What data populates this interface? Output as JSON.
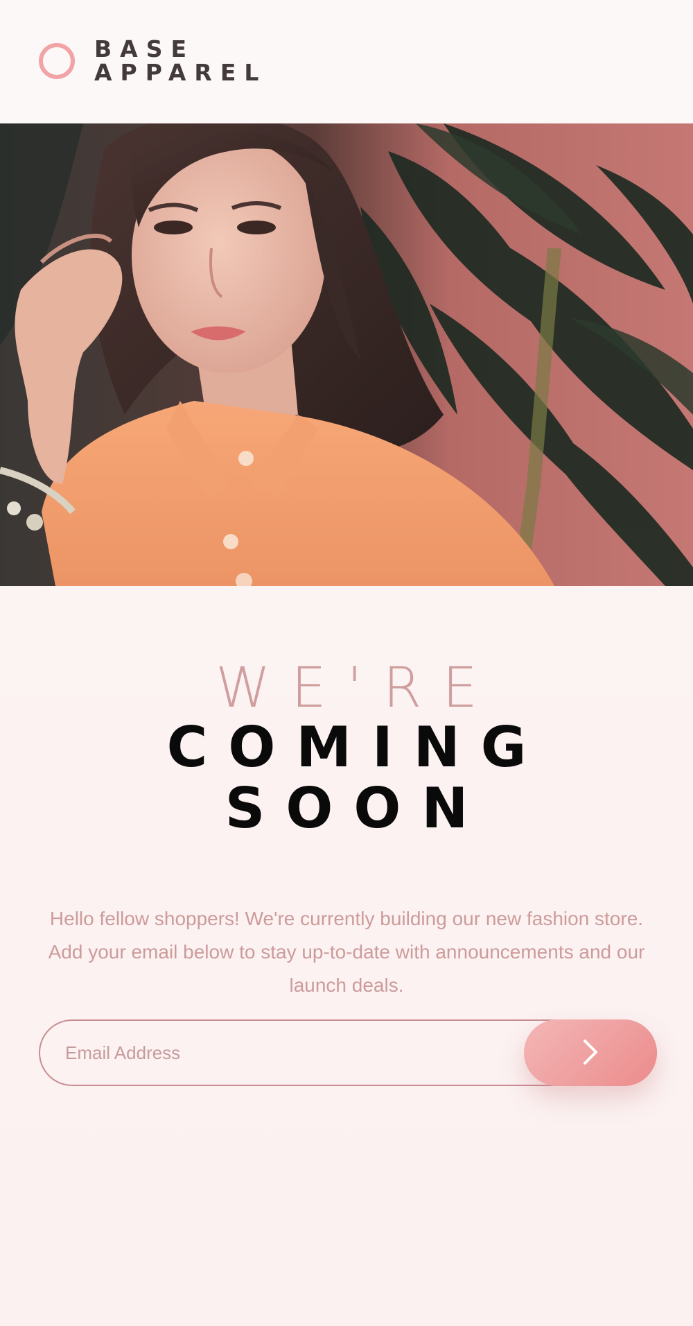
{
  "brand": {
    "line1": "BASE",
    "line2": "APPAREL",
    "logo_icon": "ring-logo-icon",
    "accent": "#f1a3a5"
  },
  "headline": {
    "light": "WE'RE",
    "dark1": "COMING",
    "dark2": "SOON"
  },
  "intro": "Hello fellow shoppers! We're currently building our new fashion store. Add your email below to stay up-to-date with announcements and our launch deals.",
  "form": {
    "email_placeholder": "Email Address",
    "email_value": "",
    "submit_icon": "chevron-right-icon"
  },
  "colors": {
    "title_light": "#d09e9e",
    "title_dark": "#0b0a0b",
    "text": "#cd9b9b",
    "button_from": "#f3b7b6",
    "button_to": "#ec8b8c"
  }
}
